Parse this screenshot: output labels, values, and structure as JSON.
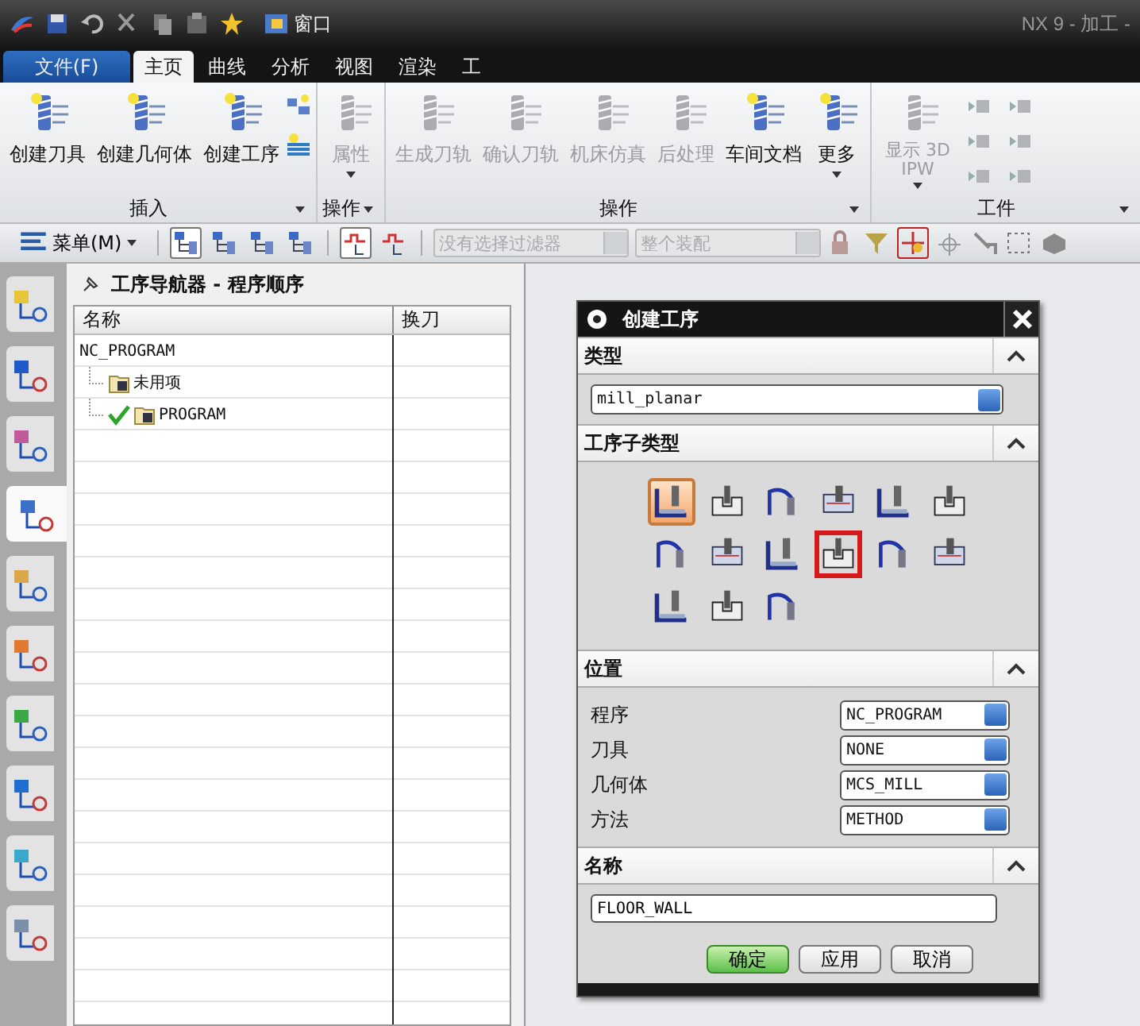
{
  "quick_access": {
    "window_menu": "窗口"
  },
  "title": "NX 9 - 加工 -",
  "tabs": [
    {
      "label": "文件(F)",
      "kind": "file",
      "selected": false
    },
    {
      "label": "主页",
      "kind": "tab",
      "selected": true
    },
    {
      "label": "曲线",
      "kind": "tab",
      "selected": false
    },
    {
      "label": "分析",
      "kind": "tab",
      "selected": false
    },
    {
      "label": "视图",
      "kind": "tab",
      "selected": false
    },
    {
      "label": "渲染",
      "kind": "tab",
      "selected": false
    },
    {
      "label": "工",
      "kind": "tab",
      "selected": false
    }
  ],
  "ribbon": {
    "groups": [
      {
        "label": "插入",
        "buttons": [
          {
            "label": "创建刀具",
            "disabled": false,
            "dropdown": false
          },
          {
            "label": "创建几何体",
            "disabled": false,
            "dropdown": false
          },
          {
            "label": "创建工序",
            "disabled": false,
            "dropdown": false
          }
        ]
      },
      {
        "label": "操作",
        "buttons": [
          {
            "label": "属性",
            "disabled": true,
            "dropdown": true
          }
        ]
      },
      {
        "label": "操作",
        "buttons": [
          {
            "label": "生成刀轨",
            "disabled": true,
            "dropdown": false
          },
          {
            "label": "确认刀轨",
            "disabled": true,
            "dropdown": false
          },
          {
            "label": "机床仿真",
            "disabled": true,
            "dropdown": false
          },
          {
            "label": "后处理",
            "disabled": true,
            "dropdown": false
          },
          {
            "label": "车间文档",
            "disabled": false,
            "dropdown": false
          },
          {
            "label": "更多",
            "disabled": false,
            "dropdown": true
          }
        ]
      },
      {
        "label": "工件",
        "buttons": [
          {
            "label": "显示 3D IPW",
            "disabled": true,
            "dropdown": true
          }
        ]
      }
    ]
  },
  "toolbar": {
    "menu": "菜单(M)",
    "view_buttons": [
      {
        "selected": true
      },
      {
        "selected": false
      },
      {
        "selected": false
      },
      {
        "selected": false
      }
    ],
    "display_buttons": [
      {
        "selected": true
      },
      {
        "selected": false
      }
    ],
    "filter": {
      "value": "没有选择过滤器",
      "disabled": true
    },
    "scope": {
      "value": "整个装配",
      "disabled": true
    }
  },
  "resource_bar": [
    {
      "selected": false
    },
    {
      "selected": false
    },
    {
      "selected": false
    },
    {
      "selected": true
    },
    {
      "selected": false
    },
    {
      "selected": false
    },
    {
      "selected": false
    },
    {
      "selected": false
    },
    {
      "selected": false
    },
    {
      "selected": false
    }
  ],
  "navigator": {
    "title": "工序导航器 - 程序顺序",
    "columns": [
      "名称",
      "换刀"
    ],
    "tree": [
      {
        "name": "NC_PROGRAM",
        "children": [
          {
            "name": "未用项",
            "checked": false
          },
          {
            "name": "PROGRAM",
            "checked": true
          }
        ]
      }
    ]
  },
  "dialog": {
    "title": "创建工序",
    "sections": [
      {
        "kind": "dropdown",
        "title": "类型",
        "expanded": true,
        "value": "mill_planar"
      },
      {
        "kind": "icons",
        "title": "工序子类型",
        "expanded": true,
        "items": [
          {
            "selected": true,
            "highlighted": false
          },
          {
            "selected": false,
            "highlighted": false
          },
          {
            "selected": false,
            "highlighted": false
          },
          {
            "selected": false,
            "highlighted": false
          },
          {
            "selected": false,
            "highlighted": false
          },
          {
            "selected": false,
            "highlighted": false
          },
          {
            "selected": false,
            "highlighted": false
          },
          {
            "selected": false,
            "highlighted": false
          },
          {
            "selected": false,
            "highlighted": false
          },
          {
            "selected": false,
            "highlighted": true
          },
          {
            "selected": false,
            "highlighted": false
          },
          {
            "selected": false,
            "highlighted": false
          },
          {
            "selected": false,
            "highlighted": false
          },
          {
            "selected": false,
            "highlighted": false
          },
          {
            "selected": false,
            "highlighted": false
          }
        ]
      },
      {
        "kind": "fields",
        "title": "位置",
        "expanded": true,
        "fields": [
          {
            "label": "程序",
            "value": "NC_PROGRAM"
          },
          {
            "label": "刀具",
            "value": "NONE"
          },
          {
            "label": "几何体",
            "value": "MCS_MILL"
          },
          {
            "label": "方法",
            "value": "METHOD"
          }
        ]
      },
      {
        "kind": "text",
        "title": "名称",
        "expanded": true,
        "value": "FLOOR_WALL"
      }
    ],
    "buttons": [
      {
        "label": "确定",
        "default": true
      },
      {
        "label": "应用",
        "default": false
      },
      {
        "label": "取消",
        "default": false
      }
    ]
  }
}
